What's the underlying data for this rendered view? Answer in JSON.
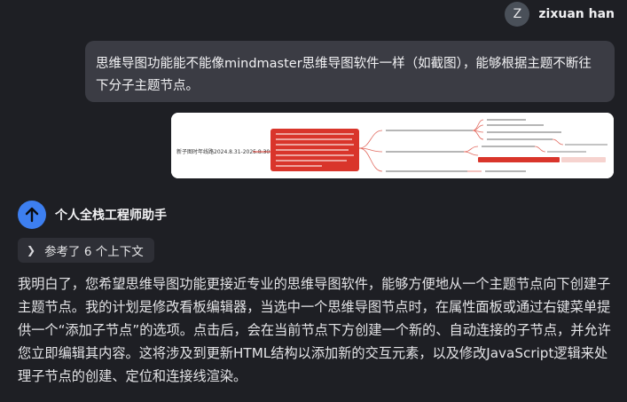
{
  "user": {
    "avatar_letter": "Z",
    "name": "zixuan han"
  },
  "user_message": {
    "text": "思维导图功能能不能像mindmaster思维导图软件一样（如截图），能够根据主题不断往下分子主题节点。"
  },
  "attachment": {
    "type": "screenshot-thumbnail",
    "root_label": "新子图时年线路2024.8.31-2025.8.30"
  },
  "assistant": {
    "name": "个人全栈工程师助手",
    "icon": "arrow-up-icon",
    "context_label": "参考了 6 个上下文",
    "reply": "我明白了，您希望思维导图功能更接近专业的思维导图软件，能够方便地从一个主题节点向下创建子主题节点。我的计划是修改看板编辑器，当选中一个思维导图节点时，在属性面板或通过右键菜单提供一个“添加子节点”的选项。点击后，会在当前节点下方创建一个新的、自动连接的子节点，并允许您立即编辑其内容。这将涉及到更新HTML结构以添加新的交互元素，以及修改JavaScript逻辑来处理子节点的创建、定位和连接线渲染。"
  },
  "colors": {
    "background": "#1e1f24",
    "user_bubble": "#3b3c44",
    "bot_avatar": "#3d7ff0",
    "mindmap_accent": "#d9352b"
  }
}
